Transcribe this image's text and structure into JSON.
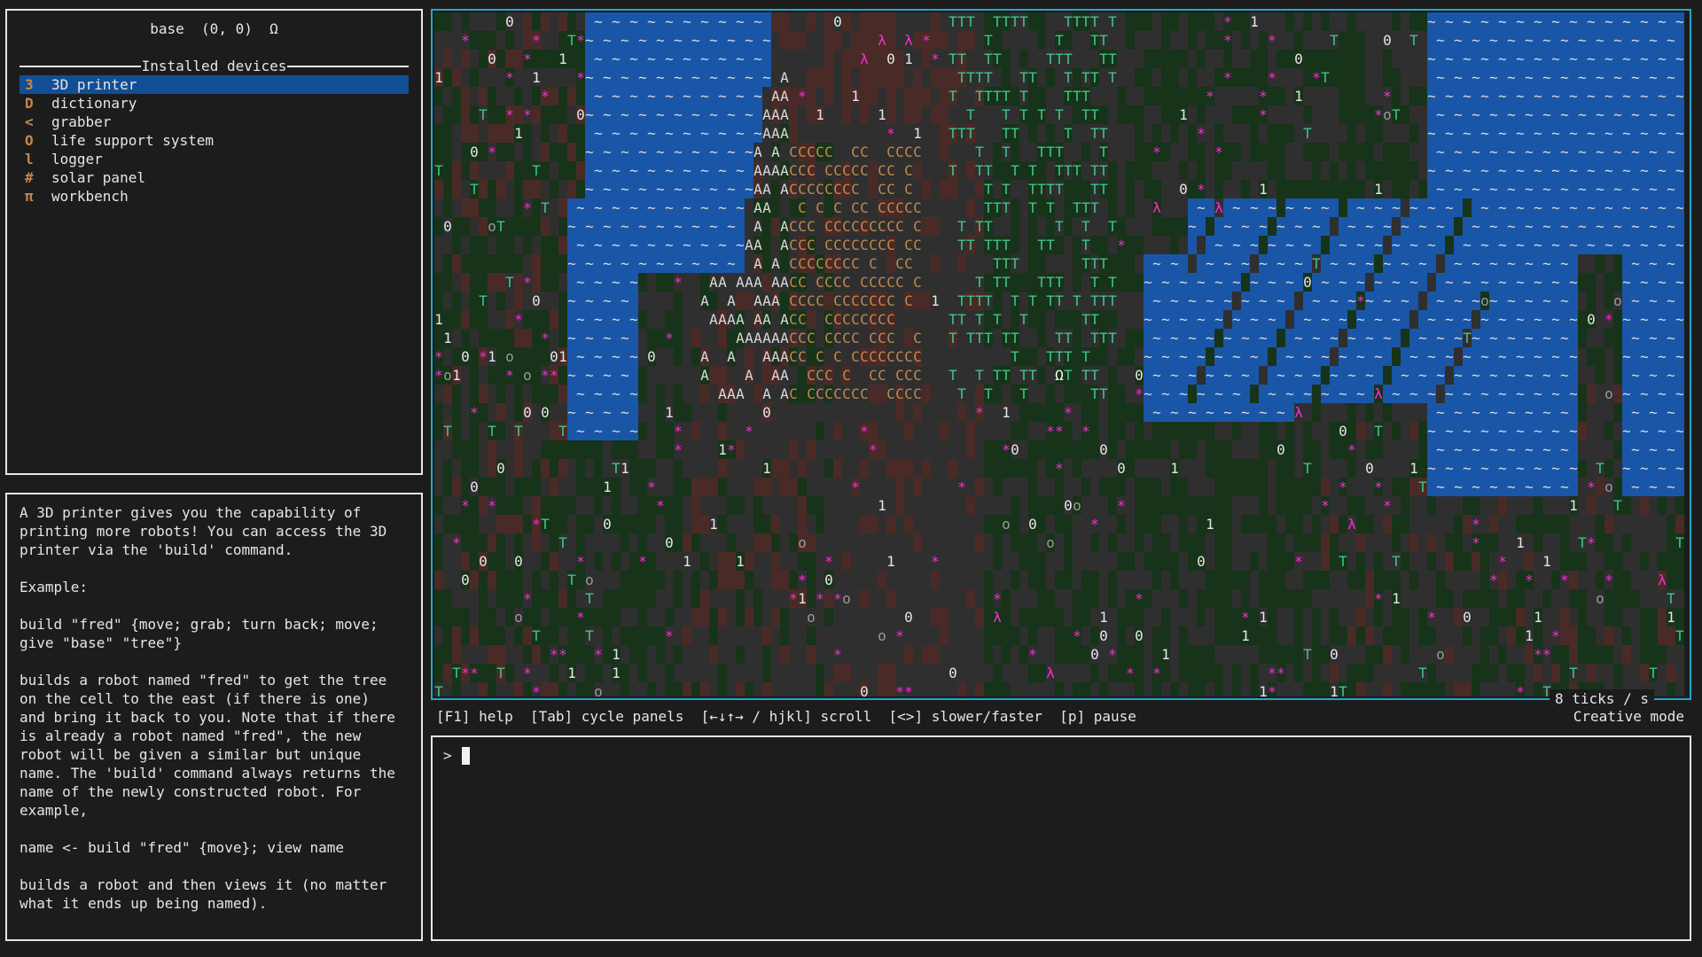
{
  "robot": {
    "name": "base",
    "position": "(0, 0)",
    "glyph": "Ω",
    "devices_title": "Installed devices",
    "devices": [
      {
        "glyph": "3",
        "name": "3D printer",
        "selected": true
      },
      {
        "glyph": "D",
        "name": "dictionary",
        "selected": false
      },
      {
        "glyph": "<",
        "name": "grabber",
        "selected": false
      },
      {
        "glyph": "O",
        "name": "life support system",
        "selected": false
      },
      {
        "glyph": "l",
        "name": "logger",
        "selected": false
      },
      {
        "glyph": "#",
        "name": "solar panel",
        "selected": false
      },
      {
        "glyph": "π",
        "name": "workbench",
        "selected": false
      }
    ]
  },
  "info": {
    "text": "A 3D printer gives you the capability of\nprinting more robots! You can access the 3D\nprinter via the 'build' command.\n\nExample:\n\nbuild \"fred\" {move; grab; turn back; move;\ngive \"base\" \"tree\"}\n\nbuilds a robot named \"fred\" to get the tree\non the cell to the east (if there is one)\nand bring it back to you. Note that if there\nis already a robot named \"fred\", the new\nrobot will be given a similar but unique\nname. The 'build' command always returns the\nname of the newly constructed robot. For\nexample,\n\nname <- build \"fred\" {move}; view name\n\nbuilds a robot and then views it (no matter\nwhat it ends up being named)."
  },
  "world": {
    "colors": {
      "grass": "#17331a",
      "stone": "#2f2f2f",
      "water": "#1a56a8",
      "dirt": "#4a2a26",
      "tree": "#3fc58a",
      "boulder": "#d9d9d9",
      "copper": "#c4884e",
      "flower": "#ff2bd6",
      "bit": "#e6e6e6",
      "wave": "#dcdcdc",
      "lambda": "#ff2bd6"
    },
    "glyphs": {
      "water": "~",
      "tree": "T",
      "mountain": "A",
      "copper": "C",
      "flower": "*",
      "bit0": "0",
      "bit1": "1",
      "rock": "o",
      "cotton": "@",
      "lambda": "λ",
      "base": "Ω"
    }
  },
  "status": {
    "ticks": "8 ticks / s",
    "keybar": "[F1] help  [Tab] cycle panels  [←↓↑→ / hjkl] scroll  [<>] slower/faster  [p] pause",
    "mode": "Creative mode"
  },
  "repl": {
    "prompt": ">"
  }
}
